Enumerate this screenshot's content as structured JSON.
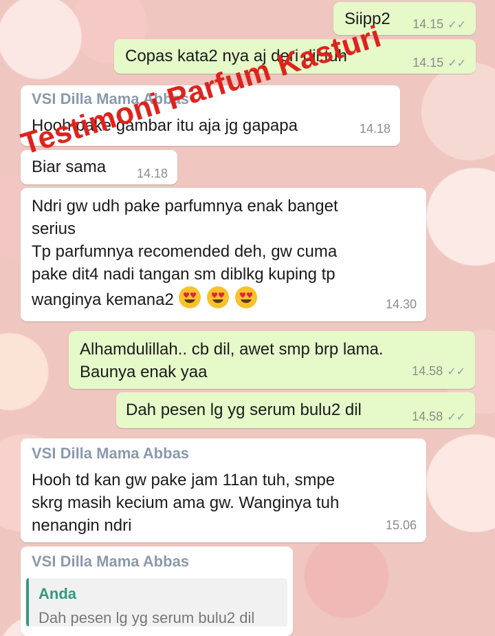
{
  "watermark": "Testimoni Parfum Kasturi",
  "messages": [
    {
      "direction": "out",
      "text": "Siipp2",
      "time": "14.15",
      "ticks": "✓✓"
    },
    {
      "direction": "out",
      "text": "Copas kata2 nya aj deri dil tuh",
      "time": "14.15",
      "ticks": "✓✓"
    },
    {
      "direction": "in",
      "sender": "VSI Dilla Mama Abbas",
      "text": "Hooh pake gambar itu aja jg gapapa",
      "time": "14.18"
    },
    {
      "direction": "in",
      "text": "Biar sama",
      "time": "14.18"
    },
    {
      "direction": "in",
      "lines": [
        "Ndri gw udh pake parfumnya enak banget",
        "serius",
        "Tp parfumnya recomended deh, gw cuma",
        "pake dit4 nadi tangan sm diblkg kuping tp",
        "wanginya kemana2"
      ],
      "emojis": [
        "heart-eyes-emoji",
        "heart-eyes-emoji",
        "heart-eyes-emoji"
      ],
      "time": "14.30"
    },
    {
      "direction": "out",
      "lines": [
        "Alhamdulillah.. cb dil, awet smp brp lama.",
        "Baunya enak yaa"
      ],
      "time": "14.58",
      "ticks": "✓✓"
    },
    {
      "direction": "out",
      "text": "Dah pesen lg yg serum bulu2 dil",
      "time": "14.58",
      "ticks": "✓✓"
    },
    {
      "direction": "in",
      "sender": "VSI Dilla Mama Abbas",
      "lines": [
        "Hooh td kan gw pake jam 11an tuh, smpe",
        "skrg masih kecium ama gw. Wanginya tuh",
        "nenangin ndri"
      ],
      "time": "15.06"
    },
    {
      "direction": "in",
      "sender": "VSI Dilla Mama Abbas",
      "quote": {
        "author": "Anda",
        "text": "Dah pesen lg yg serum bulu2 dil"
      }
    }
  ],
  "colors": {
    "incoming": "#ffffff",
    "outgoing": "#e5f9c9",
    "sender": "#8a99ad",
    "quote_bar": "#35987f",
    "watermark": "#e0221c"
  }
}
